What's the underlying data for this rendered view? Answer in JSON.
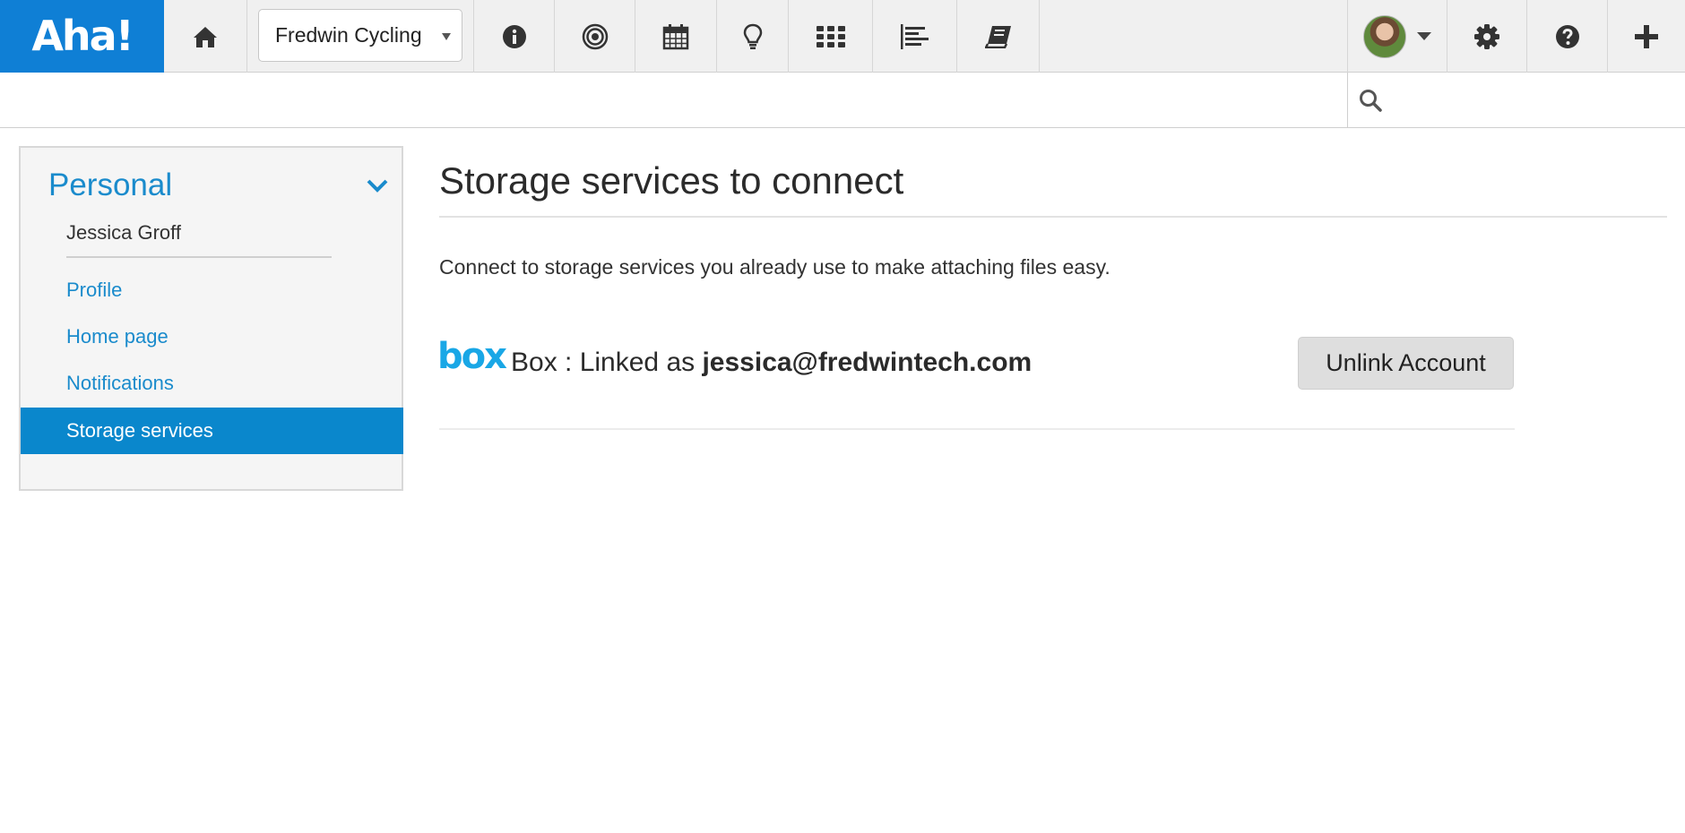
{
  "header": {
    "logo_text": "Aha!",
    "product_selector": "Fredwin Cycling",
    "search": {
      "placeholder": "",
      "value": ""
    },
    "nav_icons": [
      "home-icon",
      "info-icon",
      "target-icon",
      "calendar-icon",
      "lightbulb-icon",
      "grid-icon",
      "roadmap-icon",
      "book-icon"
    ],
    "right_icons": [
      "avatar",
      "gear-icon",
      "help-icon",
      "plus-icon"
    ]
  },
  "sidebar": {
    "section_title": "Personal",
    "user_name": "Jessica Groff",
    "items": [
      {
        "label": "Profile",
        "active": false
      },
      {
        "label": "Home page",
        "active": false
      },
      {
        "label": "Notifications",
        "active": false
      },
      {
        "label": "Storage services",
        "active": true
      }
    ]
  },
  "main": {
    "title": "Storage services to connect",
    "intro": "Connect to storage services you already use to make attaching files easy.",
    "services": [
      {
        "logo_text": "box",
        "name": "Box",
        "status_prefix": "Box : Linked as ",
        "account": "jessica@fredwintech.com",
        "action_label": "Unlink Account"
      }
    ]
  },
  "colors": {
    "brand": "#0f7fd5",
    "link": "#1a8bcc",
    "active_bg": "#0a87cc",
    "box_logo": "#19a7e6"
  }
}
